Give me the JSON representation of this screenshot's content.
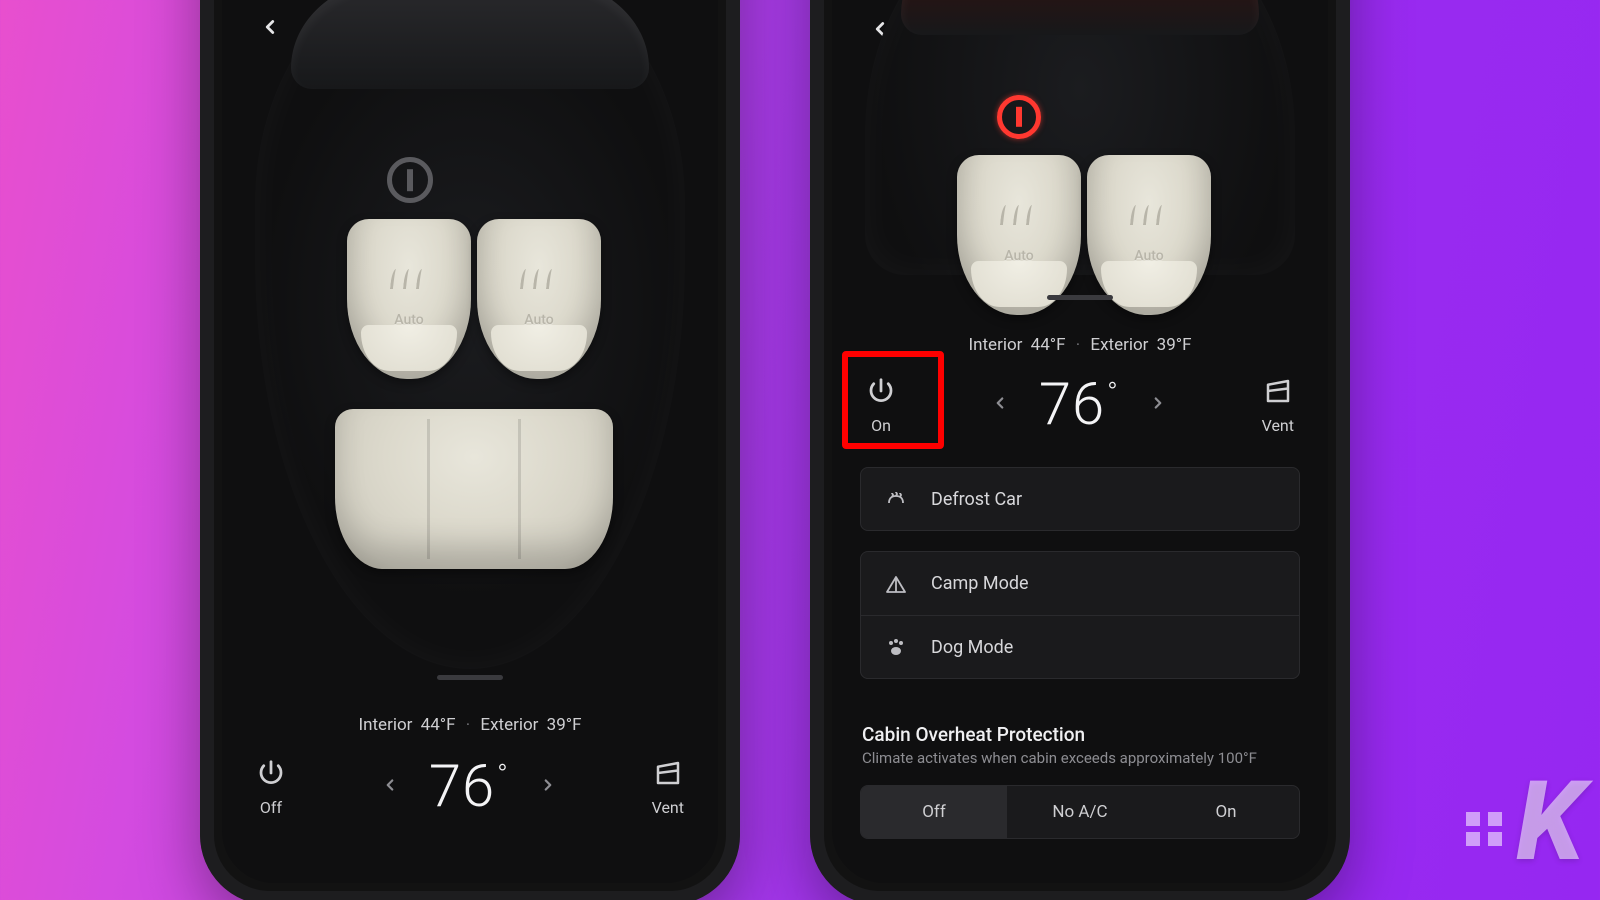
{
  "left": {
    "interior_label": "Interior",
    "interior_temp": "44°F",
    "exterior_label": "Exterior",
    "exterior_temp": "39°F",
    "power_label": "Off",
    "temperature": "76",
    "vent_label": "Vent",
    "seat_mode": "Auto"
  },
  "right": {
    "interior_label": "Interior",
    "interior_temp": "44°F",
    "exterior_label": "Exterior",
    "exterior_temp": "39°F",
    "power_label": "On",
    "temperature": "76",
    "vent_label": "Vent",
    "seat_mode": "Auto",
    "options": {
      "defrost": "Defrost Car",
      "camp": "Camp Mode",
      "dog": "Dog Mode"
    },
    "overheat": {
      "title": "Cabin Overheat Protection",
      "subtitle": "Climate activates when cabin exceeds approximately 100°F",
      "choices": [
        "Off",
        "No A/C",
        "On"
      ],
      "selected_index": 0
    }
  },
  "watermark": "K"
}
